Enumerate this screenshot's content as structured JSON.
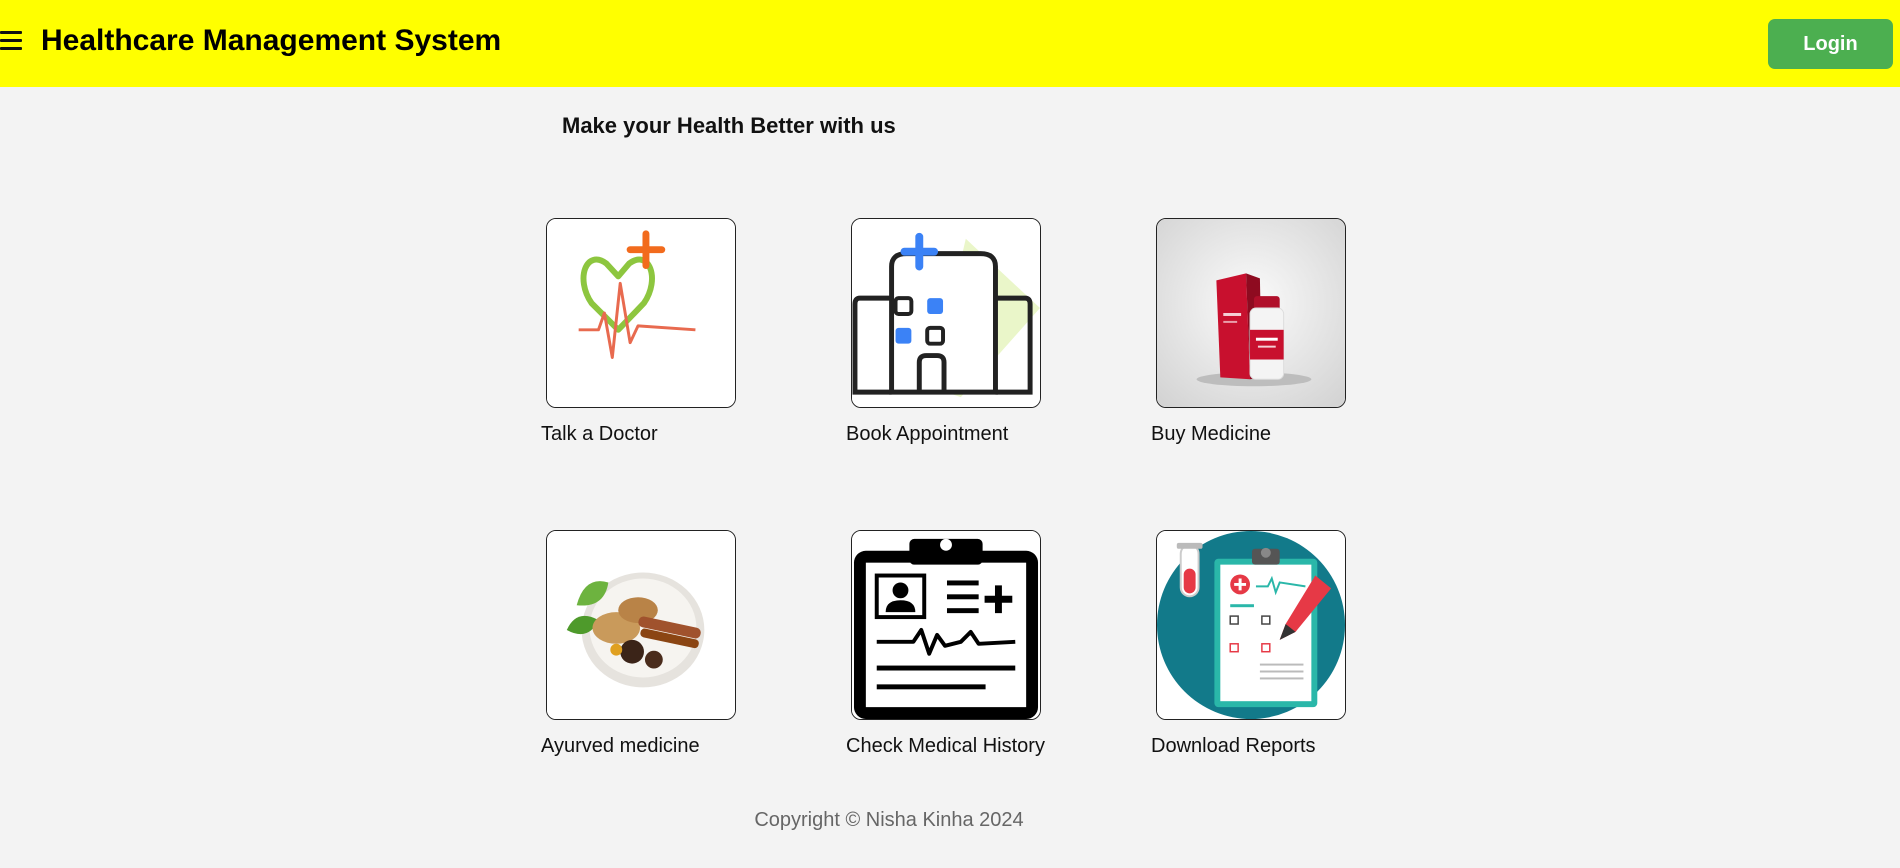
{
  "header": {
    "title": "Healthcare Management System",
    "login_label": "Login",
    "background": "#ffff00",
    "login_color": "#4caf50"
  },
  "main": {
    "tagline": "Make your Health Better with us",
    "services": [
      {
        "label": "Talk a Doctor",
        "icon": "heart-pulse-icon"
      },
      {
        "label": "Book Appointment",
        "icon": "hospital-building-icon"
      },
      {
        "label": "Buy Medicine",
        "icon": "medicine-bottle-icon"
      },
      {
        "label": "Ayurved medicine",
        "icon": "herbs-bowl-icon"
      },
      {
        "label": "Check Medical History",
        "icon": "clipboard-record-icon"
      },
      {
        "label": "Download Reports",
        "icon": "medical-report-icon"
      }
    ]
  },
  "footer": {
    "copyright": "Copyright © Nisha Kinha 2024"
  }
}
